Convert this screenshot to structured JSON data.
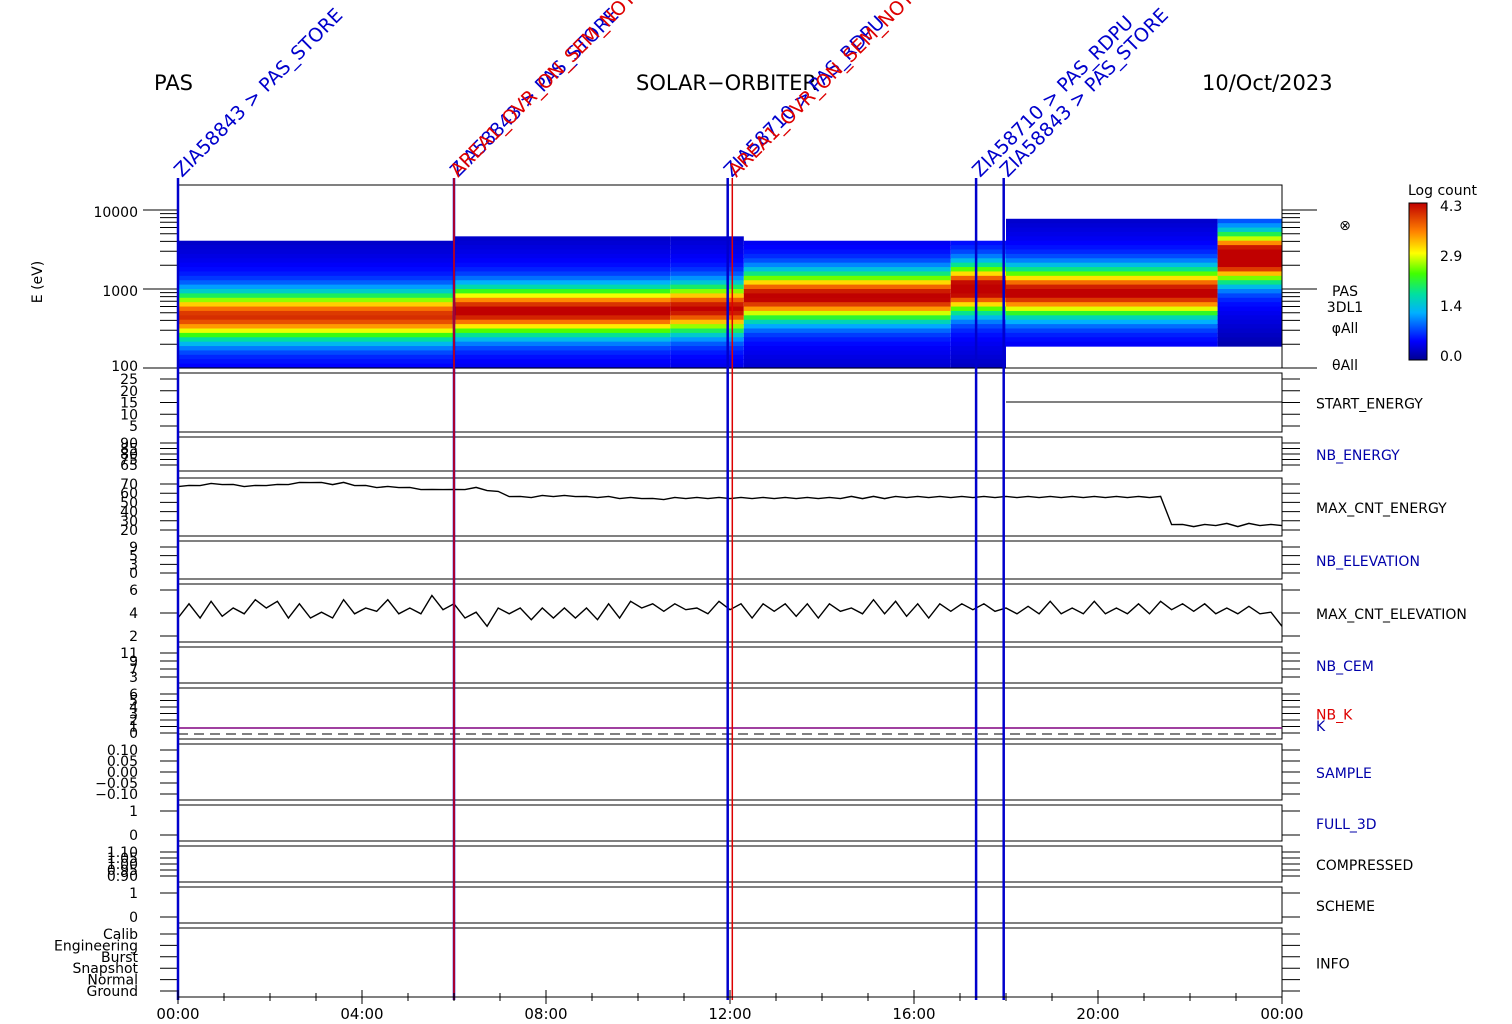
{
  "header": {
    "left": "PAS",
    "center": "SOLAR−ORBITER",
    "right": "10/Oct/2023"
  },
  "colors": {
    "blue": "#0000cc",
    "red": "#dd0000",
    "black": "#000000",
    "label_blue": "#0000aa"
  },
  "chart_data": {
    "type": "heatmap",
    "time_axis": {
      "ticks": [
        "00:00",
        "04:00",
        "08:00",
        "12:00",
        "16:00",
        "20:00",
        "00:00"
      ]
    },
    "events": [
      {
        "time_h": 0.0,
        "color": "blue",
        "labels": [
          "ZIA58843 > PAS_STORE"
        ]
      },
      {
        "time_h": 6.0,
        "color": "blue",
        "labels": [
          "ZIA58843 > PAS_STORE"
        ]
      },
      {
        "time_h": 6.0,
        "color": "red",
        "labels": [
          "AREA1_OVR_ON_SEM_NOT"
        ]
      },
      {
        "time_h": 11.95,
        "color": "blue",
        "labels": [
          "ZIA58710 > PAS_RDPU"
        ]
      },
      {
        "time_h": 12.05,
        "color": "red",
        "labels": [
          "AREA1_OVR_ON_SEM_NOT"
        ]
      },
      {
        "time_h": 17.35,
        "color": "blue",
        "labels": [
          "ZIA58710 > PAS_RDPU"
        ]
      },
      {
        "time_h": 17.95,
        "color": "blue",
        "labels": [
          "ZIA58843 > PAS_STORE"
        ]
      }
    ],
    "spectrogram": {
      "ylabel": "E (eV)",
      "yticks": [
        "10000",
        "1000",
        "100"
      ],
      "side_labels": [
        "PAS",
        "3DL1",
        "φAll",
        "θAll"
      ],
      "symbol": "⊗",
      "colorbar": {
        "title": "Log count",
        "ticks": [
          "4.3",
          "2.9",
          "1.4",
          "0.0"
        ],
        "min": 0.0,
        "max": 4.3
      }
    },
    "panels": [
      {
        "name": "START_ENERGY",
        "label_color": "black",
        "yticks": [
          "25",
          "20",
          "15",
          "10",
          "5"
        ],
        "values": []
      },
      {
        "name": "NB_ENERGY",
        "label_color": "blue",
        "yticks": [
          "90",
          "85",
          "80",
          "75",
          "65"
        ],
        "values": []
      },
      {
        "name": "MAX_CNT_ENERGY",
        "label_color": "black",
        "yticks": [
          "70",
          "60",
          "50",
          "40",
          "30",
          "20"
        ],
        "ylim": [
          20,
          70
        ],
        "values": [
          66,
          66,
          67,
          68,
          68,
          67,
          66,
          66,
          67,
          67,
          68,
          69,
          70,
          69,
          68,
          69,
          67,
          66,
          65,
          65,
          65,
          64,
          63,
          62,
          63,
          62,
          63,
          64,
          62,
          60,
          56,
          55,
          55,
          56,
          56,
          56,
          56,
          55,
          55,
          55,
          54,
          54,
          54,
          53,
          53,
          54,
          54,
          54,
          54,
          54,
          54,
          54,
          54,
          54,
          54,
          54,
          54,
          54,
          54,
          54,
          54,
          55,
          54,
          55,
          54,
          55,
          55,
          55,
          55,
          55,
          55,
          55,
          55,
          55,
          55,
          55,
          55,
          55,
          55,
          55,
          55,
          55,
          55,
          55,
          55,
          55,
          55,
          55,
          55,
          55,
          28,
          27,
          26,
          27,
          27,
          28,
          26,
          28,
          27,
          27,
          27
        ]
      },
      {
        "name": "NB_ELEVATION",
        "label_color": "blue",
        "yticks": [
          "9",
          "5",
          "3",
          "0"
        ],
        "values": []
      },
      {
        "name": "MAX_CNT_ELEVATION",
        "label_color": "black",
        "yticks": [
          "6",
          "4",
          "2"
        ],
        "ylim": [
          1,
          7
        ],
        "values": [
          4,
          4.5,
          4,
          4.8,
          4.2,
          4,
          4.5,
          5,
          5.2,
          4.8,
          4,
          4.5,
          4,
          3.5,
          4,
          5,
          4.5,
          4,
          4.8,
          5,
          4.5,
          4,
          4.5,
          5.5,
          5,
          4.5,
          4,
          3.5,
          3,
          4,
          4.5,
          4,
          3.8,
          4,
          4,
          4,
          4,
          4,
          3.8,
          4.5,
          4,
          4.8,
          5.2,
          4.5,
          4.8,
          4.5,
          5,
          4,
          4.5,
          4.8,
          5,
          4.5,
          4,
          4.5,
          4.8,
          4.5,
          4.2,
          4.5,
          4,
          4.5,
          4.8,
          4,
          4.5,
          5,
          4.5,
          4.8,
          4.2,
          4.5,
          4,
          4.5,
          4.8,
          4.5,
          5,
          4.5,
          4.8,
          4,
          4.5,
          4.2,
          4.5,
          4.8,
          4.5,
          4,
          4.5,
          4.8,
          4.5,
          4,
          4.5,
          4.5,
          4.5,
          4.8,
          5,
          4.5,
          4.8,
          4.5,
          4.5,
          4,
          4.5,
          4.2,
          4.5,
          3.5,
          3
        ]
      },
      {
        "name": "NB_CEM",
        "label_color": "blue",
        "yticks": [
          "11",
          "9",
          "7",
          "3"
        ],
        "values": []
      },
      {
        "name": "NB_K",
        "label_color": "red",
        "yticks": [
          "6",
          "5",
          "4",
          "3",
          "2",
          "1",
          "0"
        ],
        "values": []
      },
      {
        "name": "SAMPLE",
        "label_color": "blue",
        "yticks": [
          "0.10",
          "0.05",
          "0.00",
          "−0.05",
          "−0.10"
        ],
        "values": []
      },
      {
        "name": "FULL_3D",
        "label_color": "blue",
        "yticks": [
          "1",
          "0"
        ],
        "values": []
      },
      {
        "name": "COMPRESSED",
        "label_color": "black",
        "yticks": [
          "1.10",
          "1.05",
          "1.00",
          "0.95",
          "0.90"
        ],
        "values": []
      },
      {
        "name": "SCHEME",
        "label_color": "black",
        "yticks": [
          "1",
          "0"
        ],
        "values": []
      },
      {
        "name": "INFO",
        "label_color": "black",
        "yticks": [
          "Calib",
          "Engineering",
          "Burst",
          "Snapshot",
          "Normal",
          "Ground"
        ],
        "values": []
      }
    ],
    "k_label": "K"
  }
}
